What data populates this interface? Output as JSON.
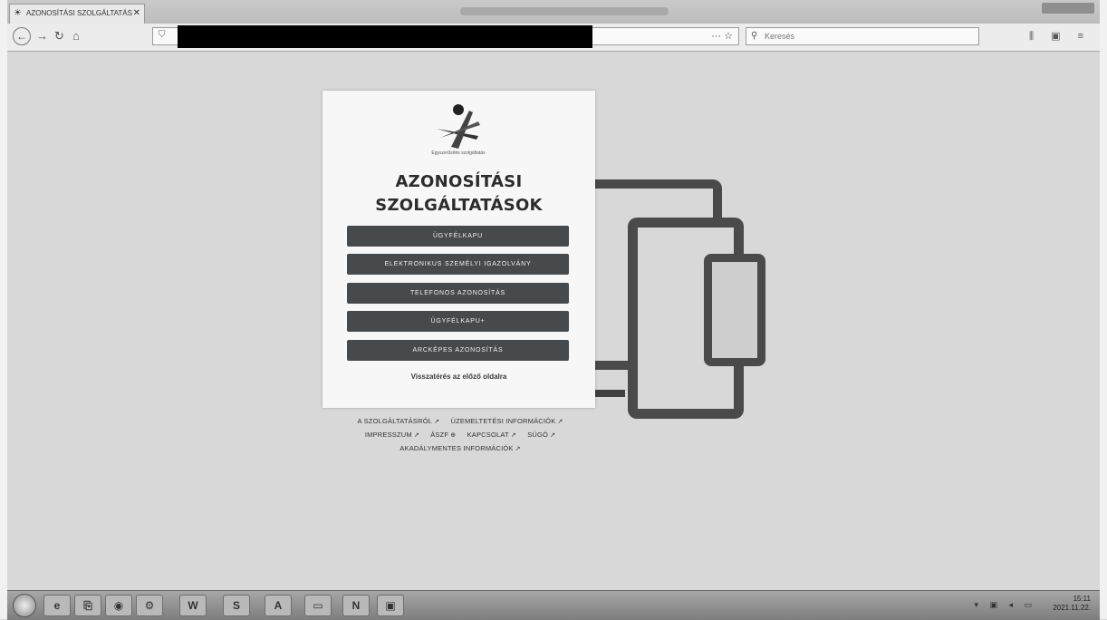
{
  "browser": {
    "tab_title": "AZONOSÍTÁSI SZOLGÁLTATÁS",
    "tab_close": "✕",
    "page_actions": "··· ☆",
    "search_placeholder": "Keresés",
    "toolbar_icons": "⫼ ▣ ≡"
  },
  "card": {
    "logo_caption": "Egyszerűsítés szolgáltatás",
    "title_line1": "AZONOSÍTÁSI",
    "title_line2": "SZOLGÁLTATÁSOK",
    "buttons": [
      "ÜGYFÉLKAPU",
      "ELEKTRONIKUS SZEMÉLYI IGAZOLVÁNY",
      "TELEFONOS AZONOSÍTÁS",
      "ÜGYFÉLKAPU+",
      "ARCKÉPES AZONOSÍTÁS"
    ],
    "back_link": "Visszatérés az előző oldalra"
  },
  "footer": {
    "links": [
      "A SZOLGÁLTATÁSRÓL",
      "ÜZEMELTETÉSI INFORMÁCIÓK",
      "IMPRESSZUM",
      "ÁSZF",
      "KAPCSOLAT",
      "SÚGÓ",
      "AKADÁLYMENTES INFORMÁCIÓK"
    ]
  },
  "taskbar": {
    "apps": [
      "e",
      "⎘",
      "◉",
      "⚙",
      "W",
      "S",
      "A",
      "▭",
      "N",
      "▣"
    ],
    "time": "15:11",
    "date": "2021.11.22."
  },
  "colors": {
    "button_bg": "#474a4c",
    "device_gray": "#4a4a4a",
    "page_bg": "#d8d8d8"
  }
}
